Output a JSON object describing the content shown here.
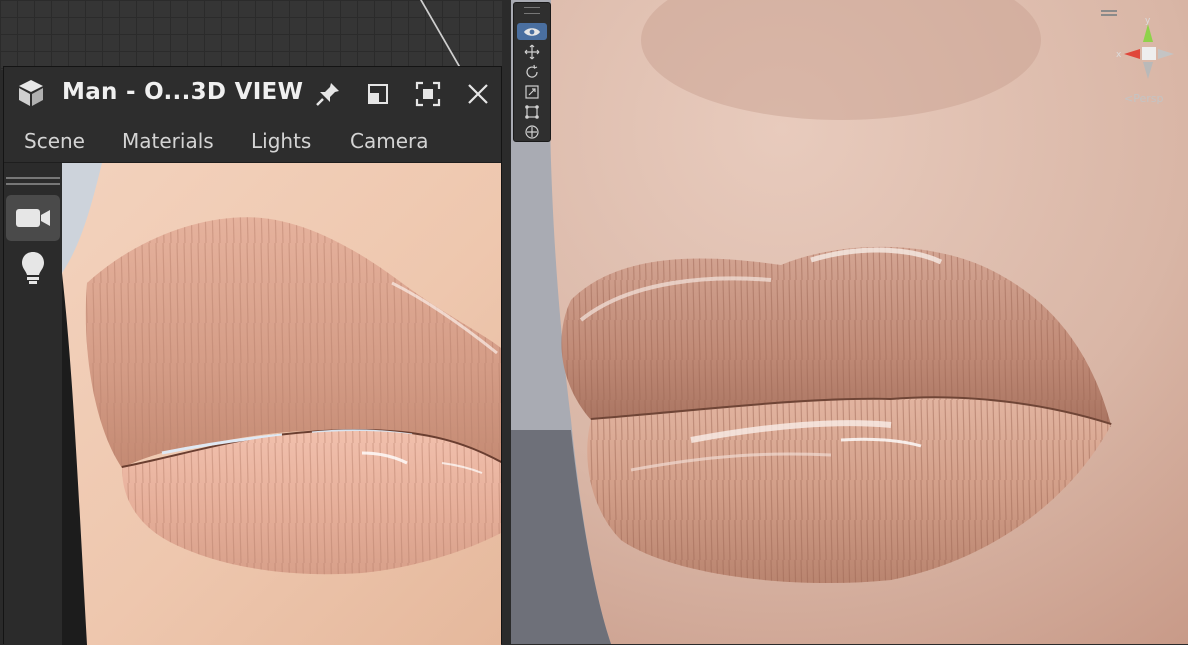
{
  "panel": {
    "title": "Man - O...3D VIEW",
    "tabs": [
      "Scene",
      "Materials",
      "Lights",
      "Camera"
    ]
  },
  "titlebar_icons": [
    "cube-logo-icon",
    "pin-icon",
    "restore-window-icon",
    "maximize-icon",
    "close-icon"
  ],
  "left_tools": [
    "camera-icon",
    "light-bulb-icon"
  ],
  "scene_tools": [
    "eye-icon",
    "move-icon",
    "rotate-icon",
    "scale-icon",
    "rect-tool-icon",
    "transform-icon"
  ],
  "gizmo": {
    "y_label": "y",
    "x_label": "x",
    "projection": "Persp"
  },
  "colors": {
    "panel_bg": "#2d2d2d",
    "active_tool": "#4a6fa0",
    "gizmo_x": "#e0463a",
    "gizmo_y": "#8ed24a",
    "gizmo_z": "#cfcfcf"
  }
}
